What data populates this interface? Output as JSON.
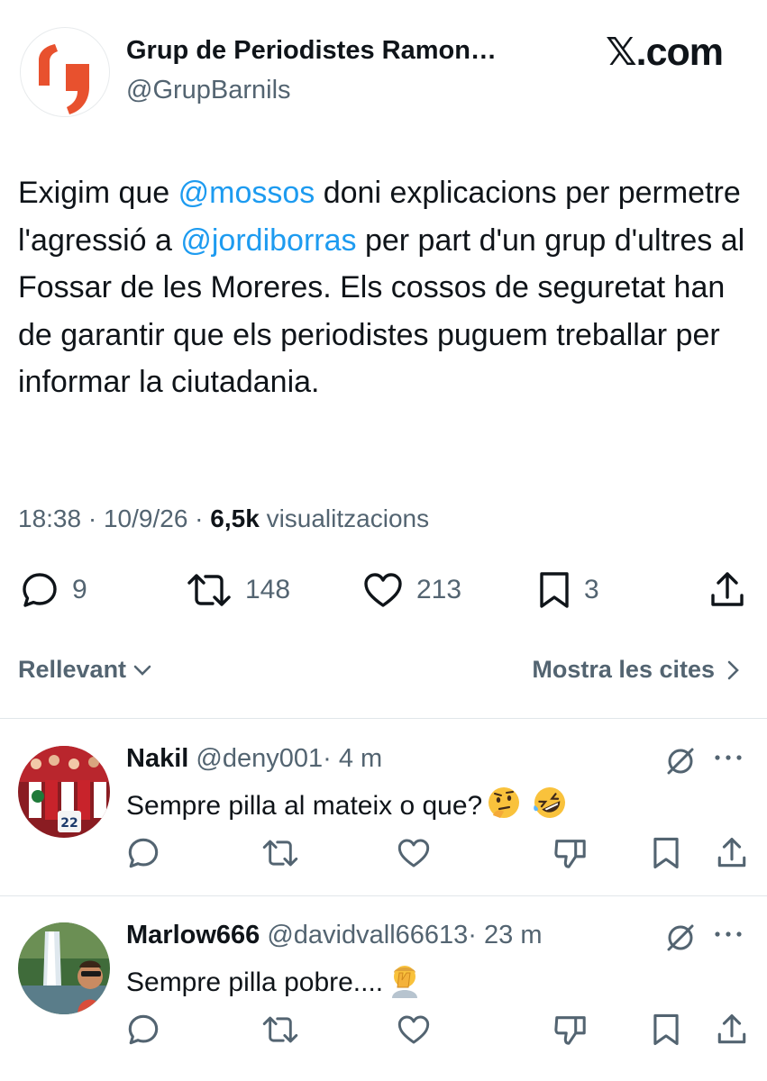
{
  "brand": {
    "site_label": "𝕏.com"
  },
  "tweet": {
    "author_name": "Grup de Periodistes Ramon…",
    "author_handle": "@GrupBarnils",
    "text_part1": "Exigim que ",
    "mention1": "@mossos",
    "text_part2": " doni explicacions per permetre l'agressió a ",
    "mention2": "@jordiborras",
    "text_part3": " per part d'un grup d'ultres al Fossar de les Moreres. Els cossos de seguretat han de garantir que els periodistes puguem treballar per informar la ciutadania.",
    "time": "18:38",
    "date": "10/9/26",
    "views_count": "6,5k",
    "views_label": "visualitzacions",
    "sep": " · ",
    "replies": "9",
    "reposts": "148",
    "likes": "213",
    "bookmarks": "3"
  },
  "sort": {
    "relevance_label": "Rellevant",
    "quotes_label": "Mostra les cites"
  },
  "replies": [
    {
      "name": "Nakil",
      "handle": "@deny001",
      "time": "· 4 m",
      "text": "Sempre pilla al mateix o que?"
    },
    {
      "name": "Marlow666",
      "handle": "@davidvall66613",
      "time": "· 23 m",
      "text": "Sempre pilla pobre...."
    }
  ],
  "colors": {
    "link": "#1d9bf0",
    "text": "#0f1419",
    "muted": "#536471",
    "brand_orange": "#e8512e"
  }
}
